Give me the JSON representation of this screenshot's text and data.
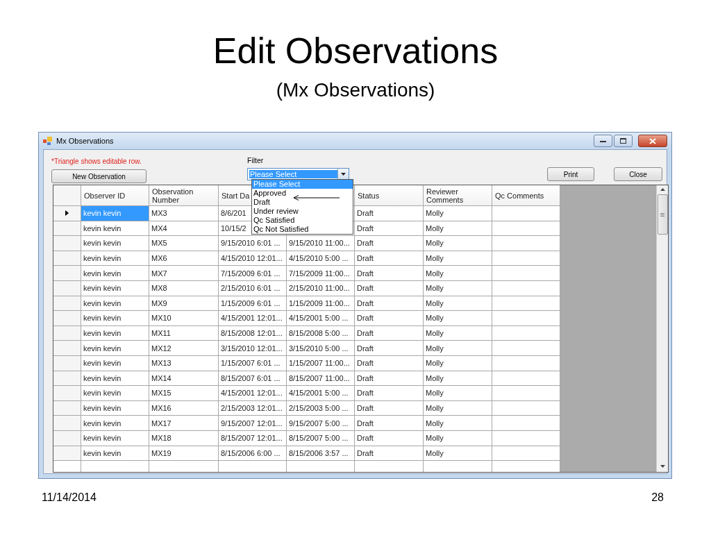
{
  "slide": {
    "title": "Edit Observations",
    "subtitle": "(Mx Observations)",
    "date": "11/14/2014",
    "page_number": "28"
  },
  "window": {
    "title": "Mx Observations",
    "note": "*Triangle shows editable row.",
    "filter_label": "Filter",
    "new_button": "New Observation",
    "print_button": "Print",
    "close_button": "Close"
  },
  "filter": {
    "value": "Please Select",
    "expanded": true,
    "options": [
      {
        "label": "Please Select",
        "selected": true
      },
      {
        "label": "Approved",
        "selected": false
      },
      {
        "label": "Draft",
        "selected": false
      },
      {
        "label": "Under review",
        "selected": false
      },
      {
        "label": "Qc Satisfied",
        "selected": false
      },
      {
        "label": "Qc Not Satisfied",
        "selected": false
      }
    ]
  },
  "table": {
    "headers": [
      "Observer ID",
      "Observation Number",
      "Start Da",
      "Status",
      "Reviewer Comments",
      "Qc Comments"
    ],
    "rows": [
      {
        "selected": true,
        "observer_id": "kevin kevin",
        "observation_number": "MX3",
        "start_date": "8/6/201",
        "status": "Draft",
        "reviewer_comments": "Molly"
      },
      {
        "selected": false,
        "observer_id": "kevin kevin",
        "observation_number": "MX4",
        "start_date": "10/15/2",
        "status": "Draft",
        "reviewer_comments": "Molly"
      },
      {
        "selected": false,
        "observer_id": "kevin kevin",
        "observation_number": "MX5",
        "start_date": "9/15/2010 6:01 ...",
        "end_date": "9/15/2010 11:00...",
        "status": "Draft",
        "reviewer_comments": "Molly"
      },
      {
        "selected": false,
        "observer_id": "kevin kevin",
        "observation_number": "MX6",
        "start_date": "4/15/2010 12:01...",
        "end_date": "4/15/2010 5:00 ...",
        "status": "Draft",
        "reviewer_comments": "Molly"
      },
      {
        "selected": false,
        "observer_id": "kevin kevin",
        "observation_number": "MX7",
        "start_date": "7/15/2009 6:01 ...",
        "end_date": "7/15/2009 11:00...",
        "status": "Draft",
        "reviewer_comments": "Molly"
      },
      {
        "selected": false,
        "observer_id": "kevin kevin",
        "observation_number": "MX8",
        "start_date": "2/15/2010 6:01 ...",
        "end_date": "2/15/2010 11:00...",
        "status": "Draft",
        "reviewer_comments": "Molly"
      },
      {
        "selected": false,
        "observer_id": "kevin kevin",
        "observation_number": "MX9",
        "start_date": "1/15/2009 6:01 ...",
        "end_date": "1/15/2009 11:00...",
        "status": "Draft",
        "reviewer_comments": "Molly"
      },
      {
        "selected": false,
        "observer_id": "kevin kevin",
        "observation_number": "MX10",
        "start_date": "4/15/2001 12:01...",
        "end_date": "4/15/2001 5:00 ...",
        "status": "Draft",
        "reviewer_comments": "Molly"
      },
      {
        "selected": false,
        "observer_id": "kevin kevin",
        "observation_number": "MX11",
        "start_date": "8/15/2008 12:01...",
        "end_date": "8/15/2008 5:00 ...",
        "status": "Draft",
        "reviewer_comments": "Molly"
      },
      {
        "selected": false,
        "observer_id": "kevin kevin",
        "observation_number": "MX12",
        "start_date": "3/15/2010 12:01...",
        "end_date": "3/15/2010 5:00 ...",
        "status": "Draft",
        "reviewer_comments": "Molly"
      },
      {
        "selected": false,
        "observer_id": "kevin kevin",
        "observation_number": "MX13",
        "start_date": "1/15/2007 6:01 ...",
        "end_date": "1/15/2007 11:00...",
        "status": "Draft",
        "reviewer_comments": "Molly"
      },
      {
        "selected": false,
        "observer_id": "kevin kevin",
        "observation_number": "MX14",
        "start_date": "8/15/2007 6:01 ...",
        "end_date": "8/15/2007 11:00...",
        "status": "Draft",
        "reviewer_comments": "Molly"
      },
      {
        "selected": false,
        "observer_id": "kevin kevin",
        "observation_number": "MX15",
        "start_date": "4/15/2001 12:01...",
        "end_date": "4/15/2001 5:00 ...",
        "status": "Draft",
        "reviewer_comments": "Molly"
      },
      {
        "selected": false,
        "observer_id": "kevin kevin",
        "observation_number": "MX16",
        "start_date": "2/15/2003 12:01...",
        "end_date": "2/15/2003 5:00 ...",
        "status": "Draft",
        "reviewer_comments": "Molly"
      },
      {
        "selected": false,
        "observer_id": "kevin kevin",
        "observation_number": "MX17",
        "start_date": "9/15/2007 12:01...",
        "end_date": "9/15/2007 5:00 ...",
        "status": "Draft",
        "reviewer_comments": "Molly"
      },
      {
        "selected": false,
        "observer_id": "kevin kevin",
        "observation_number": "MX18",
        "start_date": "8/15/2007 12:01...",
        "end_date": "8/15/2007 5:00 ...",
        "status": "Draft",
        "reviewer_comments": "Molly"
      },
      {
        "selected": false,
        "observer_id": "kevin kevin",
        "observation_number": "MX19",
        "start_date": "8/15/2006 6:00 ...",
        "end_date": "8/15/2006 3:57 ...",
        "status": "Draft",
        "reviewer_comments": "Molly"
      }
    ]
  }
}
